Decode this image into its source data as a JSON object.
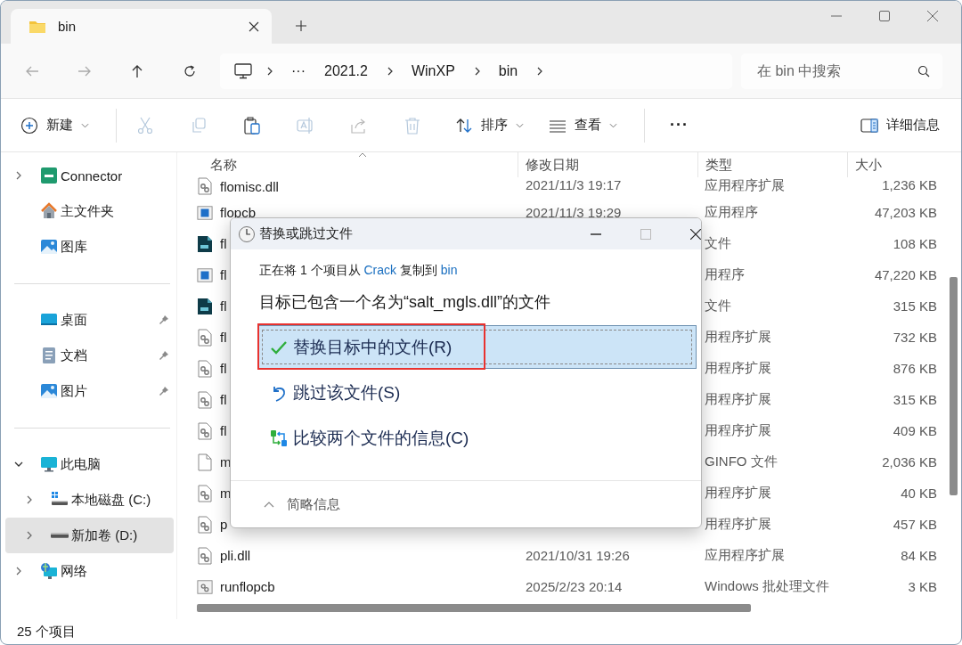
{
  "tabs": [
    {
      "title": "bin",
      "selected": true
    }
  ],
  "address_bar": {
    "overflow": "···",
    "segments": [
      "2021.2",
      "WinXP",
      "bin"
    ]
  },
  "search": {
    "placeholder": "在 bin 中搜索"
  },
  "toolbar": [
    {
      "kind": "new",
      "label": "新建",
      "disabled": false
    },
    {
      "kind": "cut",
      "disabled": true
    },
    {
      "kind": "copy",
      "disabled": true
    },
    {
      "kind": "paste",
      "disabled": false
    },
    {
      "kind": "rename",
      "disabled": true
    },
    {
      "kind": "share",
      "disabled": true
    },
    {
      "kind": "delete",
      "disabled": true
    },
    {
      "kind": "sort",
      "label": "排序",
      "disabled": false
    },
    {
      "kind": "view",
      "label": "查看",
      "disabled": false
    },
    {
      "kind": "more",
      "label": "···",
      "disabled": false
    }
  ],
  "details_button": {
    "label": "详细信息"
  },
  "sidebar": {
    "groups": [
      {
        "items": [
          {
            "kind": "cn",
            "label": "Connector",
            "expanded": false,
            "selected": false
          },
          {
            "kind": "home",
            "label": "主文件夹",
            "selected": false
          },
          {
            "kind": "gallery",
            "label": "图库",
            "selected": false
          }
        ]
      },
      {
        "items": [
          {
            "kind": "desktop",
            "label": "桌面",
            "pinned": true,
            "selected": false
          },
          {
            "kind": "documents",
            "label": "文档",
            "pinned": true,
            "selected": false
          },
          {
            "kind": "pictures",
            "label": "图片",
            "pinned": true,
            "selected": false
          }
        ]
      },
      {
        "items": [
          {
            "kind": "pc",
            "label": "此电脑",
            "expanded": true,
            "selected": false,
            "children": [
              {
                "kind": "drive-c",
                "label": "本地磁盘 (C:)",
                "expanded": false,
                "selected": false
              },
              {
                "kind": "drive",
                "label": "新加卷 (D:)",
                "expanded": false,
                "selected": true
              }
            ]
          },
          {
            "kind": "network",
            "label": "网络",
            "expanded": false,
            "selected": false
          }
        ]
      }
    ]
  },
  "columns": [
    {
      "label": "名称",
      "sorted": true
    },
    {
      "label": "修改日期",
      "sorted": false
    },
    {
      "label": "类型",
      "sorted": false
    },
    {
      "label": "大小",
      "sorted": false
    }
  ],
  "rows": [
    {
      "kind": "dll",
      "name": "flomisc.dll",
      "date": "2021/11/3 19:17",
      "type": "应用程序扩展",
      "size": "1,236 KB"
    },
    {
      "kind": "app",
      "name": "flopcb",
      "date": "2021/11/3 19:29",
      "type": "应用程序",
      "size": "47,203 KB"
    },
    {
      "kind": "flp",
      "name": "fl",
      "type": "文件",
      "size": "108 KB"
    },
    {
      "kind": "app",
      "name": "fl",
      "type": "用程序",
      "size": "47,220 KB"
    },
    {
      "kind": "flp",
      "name": "fl",
      "type": "文件",
      "size": "315 KB"
    },
    {
      "kind": "dll",
      "name": "fl",
      "type": "用程序扩展",
      "size": "732 KB"
    },
    {
      "kind": "dll",
      "name": "fl",
      "type": "用程序扩展",
      "size": "876 KB"
    },
    {
      "kind": "dll",
      "name": "fl",
      "type": "用程序扩展",
      "size": "315 KB"
    },
    {
      "kind": "dll",
      "name": "fl",
      "type": "用程序扩展",
      "size": "409 KB"
    },
    {
      "kind": "blank",
      "name": "m",
      "type": "GINFO 文件",
      "size": "2,036 KB"
    },
    {
      "kind": "dll",
      "name": "m",
      "type": "用程序扩展",
      "size": "40 KB"
    },
    {
      "kind": "dll",
      "name": "p",
      "type": "用程序扩展",
      "size": "457 KB"
    },
    {
      "kind": "dll",
      "name": "pli.dll",
      "date": "2021/10/31 19:26",
      "type": "应用程序扩展",
      "size": "84 KB"
    },
    {
      "kind": "batch",
      "name": "runflopcb",
      "date": "2025/2/23 20:14",
      "type": "Windows 批处理文件",
      "size": "3 KB"
    }
  ],
  "status_bar": {
    "item_count": "25 个项目"
  },
  "dialog": {
    "title": "替换或跳过文件",
    "summary": [
      "正在将 1 个项目从 ",
      "Crack",
      " 复制到 ",
      "bin"
    ],
    "message": "目标已包含一个名为“salt_mgls.dll”的文件",
    "options": [
      {
        "kind": "replace",
        "label": "替换目标中的文件(R)",
        "selected": true
      },
      {
        "kind": "skip",
        "label": "跳过该文件(S)",
        "selected": false
      },
      {
        "kind": "compare",
        "label": "比较两个文件的信息(C)",
        "selected": false
      }
    ],
    "details_toggle": "简略信息"
  }
}
